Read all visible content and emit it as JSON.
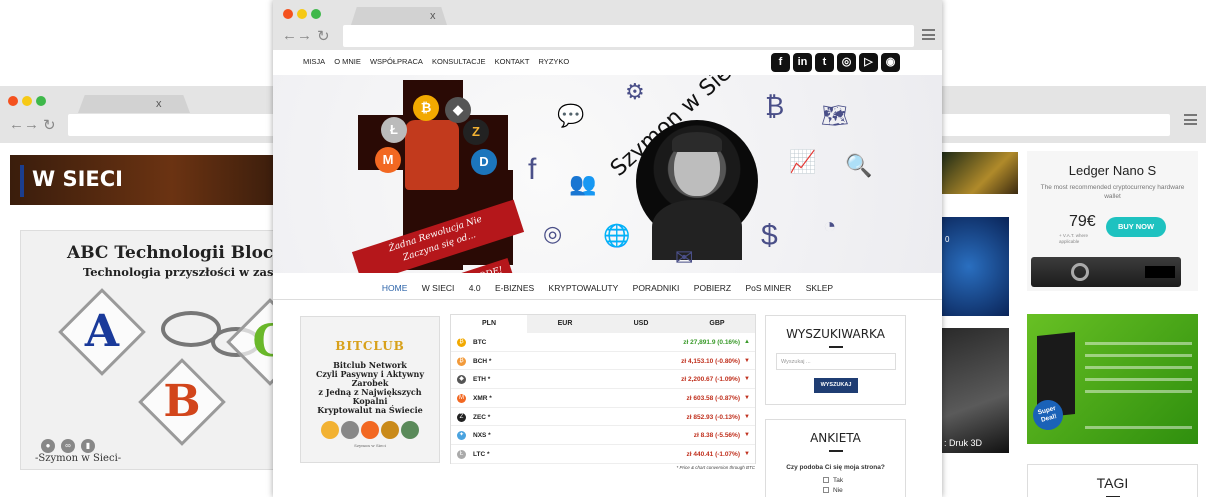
{
  "left_window": {
    "tab_close": "x",
    "banner_title": "W SIECI",
    "abc_title": "ABC Technologii Blockch",
    "abc_subtitle": "Technologia przyszłości w zasięgu Twojej r",
    "abc_signature": "-Szymon w Sieci-"
  },
  "center_window": {
    "tab_close": "x",
    "top_menu": [
      "MISJA",
      "O MNIE",
      "WSPÓŁPRACA",
      "KONSULTACJE",
      "KONTAKT",
      "RYZYKO"
    ],
    "socials": [
      "facebook-icon",
      "linkedin-icon",
      "twitter-icon",
      "instagram-icon",
      "slideshare-icon",
      "steemit-icon"
    ],
    "hero": {
      "title": "Szymon w Sieci",
      "ribbon_line1": "Żadna Rewolucja Nie",
      "ribbon_line2": "Zaczyna się od...",
      "ribbon_line3": "Pytania o ZGODĘ!"
    },
    "main_nav": [
      "HOME",
      "W SIECI",
      "4.0",
      "E-BIZNES",
      "KRYPTOWALUTY",
      "PORADNIKI",
      "POBIERZ",
      "PoS MINER",
      "SKLEP"
    ],
    "bitclub": {
      "logo": "BITCLUB",
      "line1": "Bitclub Network",
      "line2": "Czyli Pasywny i Aktywny Zarobek",
      "line3": "z Jedną z Największych Kopalni",
      "line4": "Kryptowalut na Świecie",
      "small": "Szymon w Sieci"
    },
    "ticker": {
      "tabs": [
        "PLN",
        "EUR",
        "USD",
        "GBP"
      ],
      "rows": [
        {
          "sym": "BTC",
          "value": "zł 27,891.9 (0.16%)",
          "trend": "up",
          "color": "#f2a900",
          "glyph": "₿"
        },
        {
          "sym": "BCH *",
          "value": "zł 4,153.10 (-0.80%)",
          "trend": "down",
          "color": "#f29a3a",
          "glyph": "₿"
        },
        {
          "sym": "ETH *",
          "value": "zł 2,200.67 (-1.09%)",
          "trend": "down",
          "color": "#555555",
          "glyph": "◆"
        },
        {
          "sym": "XMR *",
          "value": "zł 603.58 (-0.87%)",
          "trend": "down",
          "color": "#f26822",
          "glyph": "M"
        },
        {
          "sym": "ZEC *",
          "value": "zł 852.93 (-0.13%)",
          "trend": "down",
          "color": "#222222",
          "glyph": "Z"
        },
        {
          "sym": "NXS *",
          "value": "zł 8.38 (-5.56%)",
          "trend": "down",
          "color": "#4aa3df",
          "glyph": "✦"
        },
        {
          "sym": "LTC *",
          "value": "zł 440.41 (-1.07%)",
          "trend": "down",
          "color": "#aaaaaa",
          "glyph": "Ł"
        }
      ],
      "note": "* Price & chart conversion through BTC"
    },
    "search": {
      "title": "WYSZUKIWARKA",
      "placeholder": "Wyszukaj ...",
      "button": "WYSZUKAJ"
    },
    "poll": {
      "title": "ANKIETA",
      "question": "Czy podoba Ci się moja strona?",
      "options": [
        "Tak",
        "Nie"
      ]
    }
  },
  "right_window": {
    "ledger": {
      "title": "Ledger Nano S",
      "subtitle": "The most recommended cryptocurrency hardware wallet",
      "price": "79€",
      "price_note": "+ V.A.T. where applicable",
      "button": "BUY NOW"
    },
    "posminer_badge": "Super Deal!",
    "tagi": "TAGI",
    "print_label": ": Druk 3D",
    "digit_label": "0"
  }
}
